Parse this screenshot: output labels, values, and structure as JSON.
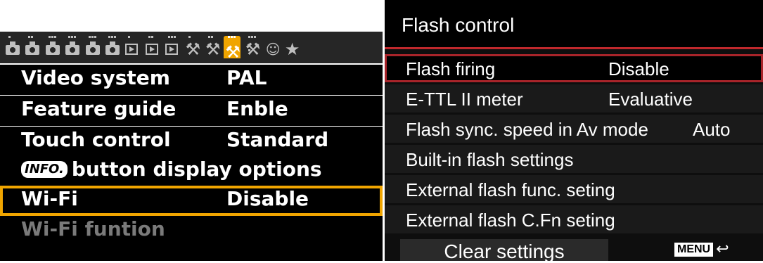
{
  "left_menu": {
    "tabs": [
      {
        "icon": "camera-icon",
        "dots": 1
      },
      {
        "icon": "camera-icon",
        "dots": 2
      },
      {
        "icon": "camera-icon",
        "dots": 3
      },
      {
        "icon": "camera-icon",
        "dots": 4
      },
      {
        "icon": "camera-icon",
        "dots": 5
      },
      {
        "icon": "camera-icon",
        "dots": 6
      },
      {
        "icon": "playback-icon",
        "dots": 1
      },
      {
        "icon": "playback-icon",
        "dots": 2
      },
      {
        "icon": "playback-icon",
        "dots": 3
      },
      {
        "icon": "wrench-icon",
        "dots": 1
      },
      {
        "icon": "wrench-icon",
        "dots": 2
      },
      {
        "icon": "wrench-icon",
        "dots": 3,
        "active": true
      },
      {
        "icon": "wrench-icon",
        "dots": 4
      },
      {
        "icon": "custom-functions-icon",
        "dots": 0
      },
      {
        "icon": "star-icon",
        "dots": 0
      }
    ],
    "rows": [
      {
        "label": "Video system",
        "value": "PAL"
      },
      {
        "label": "Feature guide",
        "value": "Enble"
      },
      {
        "label": "Touch control",
        "value": "Standard"
      },
      {
        "badge": "INFO.",
        "label": "button display options",
        "value": ""
      },
      {
        "label": "Wi-Fi",
        "value": "Disable",
        "selected": true
      },
      {
        "label": "Wi-Fi funtion",
        "value": "",
        "disabled": true
      }
    ]
  },
  "right_menu": {
    "title": "Flash control",
    "rows": [
      {
        "label": "Flash firing",
        "value": "Disable",
        "selected": true
      },
      {
        "label": "E-TTL II meter",
        "value": "Evaluative"
      },
      {
        "label": "Flash sync. speed in Av mode",
        "value": "Auto"
      },
      {
        "label": "Built-in flash settings",
        "value": ""
      },
      {
        "label": "External flash func. seting",
        "value": ""
      },
      {
        "label": "External flash C.Fn seting",
        "value": ""
      }
    ],
    "clear_button": "Clear settings",
    "menu_badge": "MENU",
    "return_icon": "↩"
  },
  "colors": {
    "accent_orange": "#f0a500",
    "accent_red": "#c0282c"
  }
}
